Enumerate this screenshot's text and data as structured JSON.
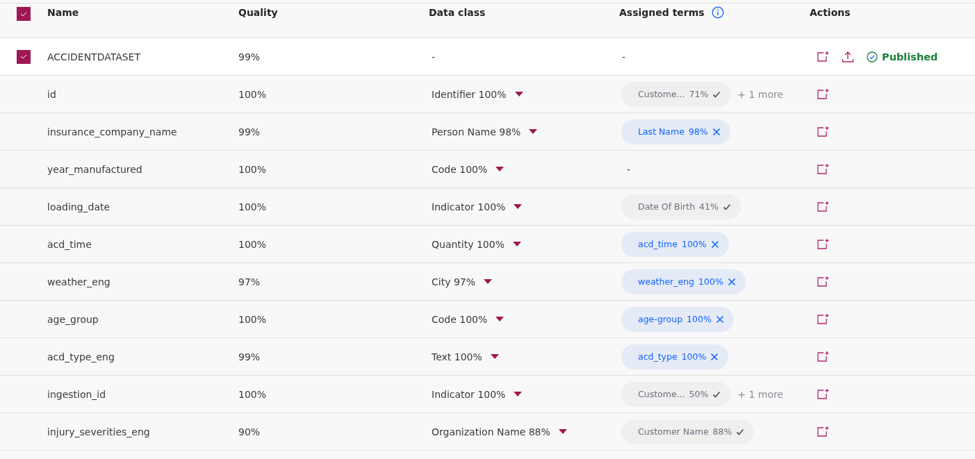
{
  "header": {
    "select_all_checked": true,
    "columns": [
      "Name",
      "Quality",
      "Data class",
      "Assigned terms",
      "Actions"
    ]
  },
  "dataset": {
    "checked": true,
    "name": "ACCIDENTDATASET",
    "quality": "99%",
    "data_class": "-",
    "assigned_terms": "-",
    "status": "Published"
  },
  "rows": [
    {
      "name": "id",
      "quality": "100%",
      "data_class": "Identifier 100%",
      "terms": [
        {
          "kind": "suggested",
          "name": "Custome...",
          "score": "71%"
        }
      ],
      "more": "+ 1 more"
    },
    {
      "name": "insurance_company_name",
      "quality": "99%",
      "data_class": "Person Name 98%",
      "terms": [
        {
          "kind": "assigned",
          "name": "Last Name",
          "score": "98%"
        }
      ]
    },
    {
      "name": "year_manufactured",
      "quality": "100%",
      "data_class": "Code 100%",
      "terms": [],
      "empty": "-"
    },
    {
      "name": "loading_date",
      "quality": "100%",
      "data_class": "Indicator 100%",
      "terms": [
        {
          "kind": "suggested",
          "name": "Date Of Birth",
          "score": "41%"
        }
      ]
    },
    {
      "name": "acd_time",
      "quality": "100%",
      "data_class": "Quantity 100%",
      "terms": [
        {
          "kind": "assigned",
          "name": "acd_time",
          "score": "100%"
        }
      ]
    },
    {
      "name": "weather_eng",
      "quality": "97%",
      "data_class": "City 97%",
      "terms": [
        {
          "kind": "assigned",
          "name": "weather_eng",
          "score": "100%"
        }
      ]
    },
    {
      "name": "age_group",
      "quality": "100%",
      "data_class": "Code 100%",
      "terms": [
        {
          "kind": "assigned",
          "name": "age-group",
          "score": "100%"
        }
      ]
    },
    {
      "name": "acd_type_eng",
      "quality": "99%",
      "data_class": "Text 100%",
      "terms": [
        {
          "kind": "assigned",
          "name": "acd_type",
          "score": "100%"
        }
      ]
    },
    {
      "name": "ingestion_id",
      "quality": "100%",
      "data_class": "Indicator 100%",
      "terms": [
        {
          "kind": "suggested",
          "name": "Custome...",
          "score": "50%"
        }
      ],
      "more": "+ 1 more"
    },
    {
      "name": "injury_severities_eng",
      "quality": "90%",
      "data_class": "Organization Name 88%",
      "terms": [
        {
          "kind": "suggested",
          "name": "Customer Name",
          "score": "88%"
        }
      ]
    }
  ]
}
